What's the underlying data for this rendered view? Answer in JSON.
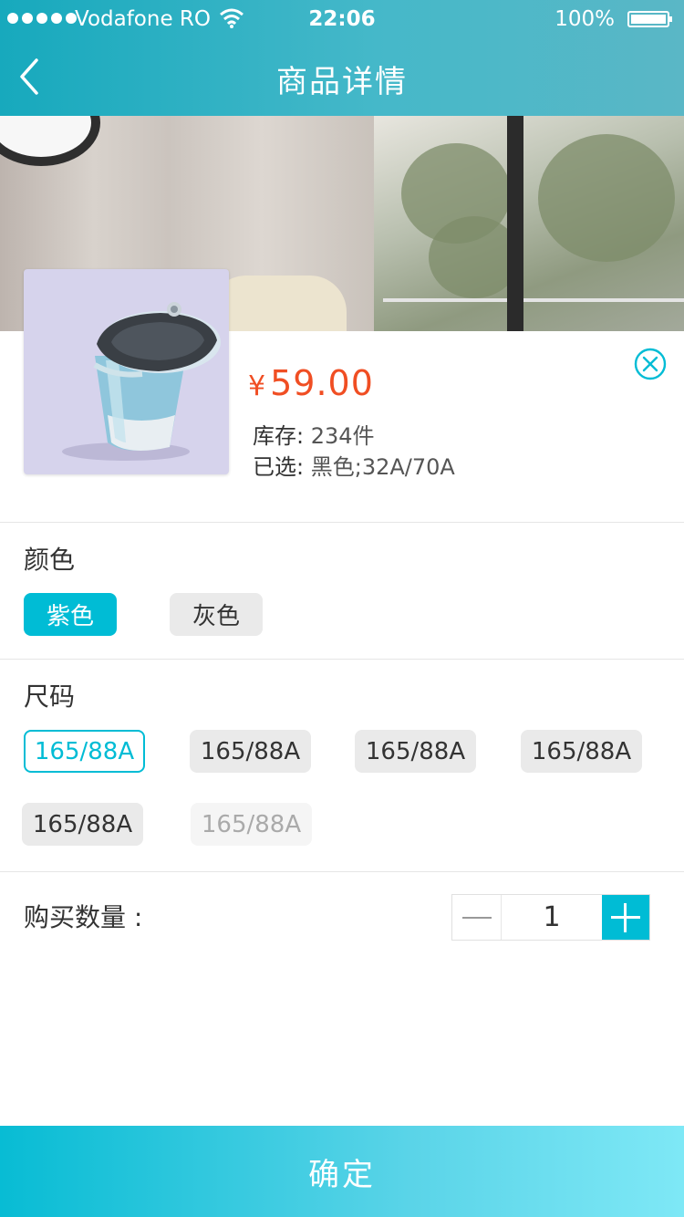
{
  "status_bar": {
    "carrier": "Vodafone RO",
    "time": "22:06",
    "battery": "100%"
  },
  "nav": {
    "title": "商品详情",
    "back_icon": "chevron-left-icon"
  },
  "product": {
    "currency_symbol": "¥",
    "price": "59.00",
    "stock_label": "库存:",
    "stock_value": "234件",
    "selected_label": "已选:",
    "selected_value": "黑色;32A/70A",
    "close_icon": "close-circle-icon"
  },
  "color_section": {
    "title": "颜色",
    "options": [
      "紫色",
      "灰色"
    ],
    "selected_index": 0
  },
  "size_section": {
    "title": "尺码",
    "options": [
      "165/88A",
      "165/88A",
      "165/88A",
      "165/88A",
      "165/88A",
      "165/88A"
    ],
    "selected_index": 0,
    "disabled_index": 5
  },
  "quantity": {
    "label": "购买数量 :",
    "value": "1"
  },
  "confirm_label": "确定",
  "colors": {
    "accent": "#00bcd5",
    "price": "#f04e23",
    "chip_background": "#eaeaea",
    "text": "#333333"
  }
}
